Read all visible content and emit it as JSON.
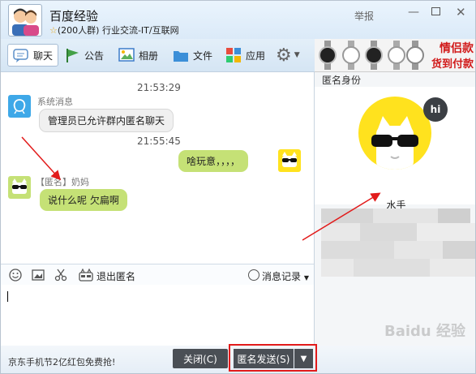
{
  "window": {
    "group_name": "百度经验",
    "group_info": "(200人群) 行业交流-IT/互联网",
    "report": "举报"
  },
  "tabs": [
    {
      "label": "聊天",
      "icon": "chat-icon"
    },
    {
      "label": "公告",
      "icon": "flag-icon"
    },
    {
      "label": "相册",
      "icon": "photo-icon"
    },
    {
      "label": "文件",
      "icon": "folder-icon"
    },
    {
      "label": "应用",
      "icon": "apps-icon"
    }
  ],
  "ad_banner": {
    "line1": "情侣款",
    "line2": "货到付款"
  },
  "messages": {
    "time1": "21:53:29",
    "system_sender": "系统消息",
    "system_text": "管理员已允许群内匿名聊天",
    "time2": "21:55:45",
    "my_text": "啥玩意，，，，",
    "anon_sender": "【匿名】奶妈",
    "anon_text": "说什么呢   欠扁啊"
  },
  "toolbar": {
    "exit_anon": "退出匿名",
    "history": "消息记录"
  },
  "bottom": {
    "ad_text": "京东手机节2亿红包免费抢!",
    "close_label": "关闭(C)",
    "send_label": "匿名发送(S)"
  },
  "right_panel": {
    "title": "匿名身份",
    "badge": "hi",
    "anon_name": "水手"
  },
  "watermark": "Baidu 经验",
  "colors": {
    "bubble_green": "#c5e176",
    "avatar_yellow": "#ffe21e",
    "highlight_red": "#e21b1b"
  }
}
